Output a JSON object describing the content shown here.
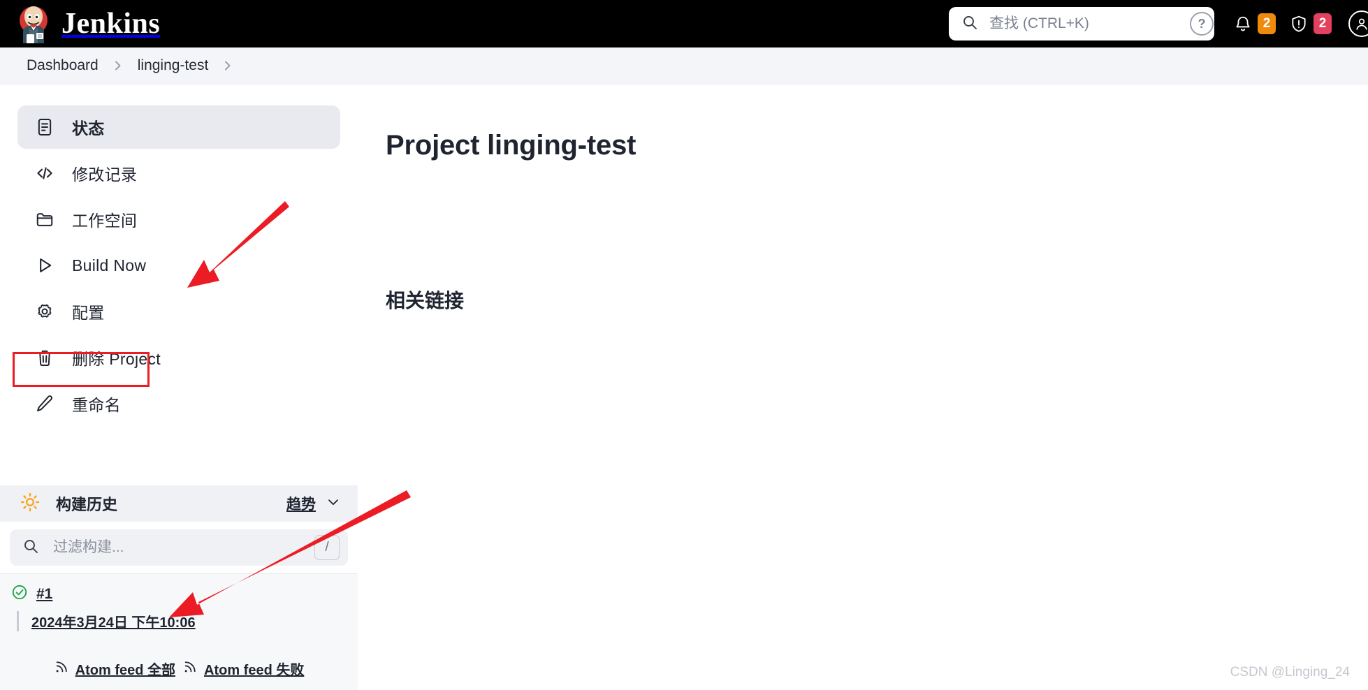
{
  "header": {
    "brand_title": "Jenkins",
    "logo_icon": "jenkins-butler-logo",
    "search": {
      "placeholder": "查找 (CTRL+K)",
      "value": "",
      "icon": "search-icon"
    },
    "help_icon_label": "?",
    "notifications": {
      "bell_icon": "bell-icon",
      "count": "2",
      "color": "#ef8b0c"
    },
    "security": {
      "shield_icon": "shield-warning-icon",
      "count": "2",
      "color": "#e4405f"
    },
    "account_icon": "user-avatar-icon"
  },
  "breadcrumb": {
    "items": [
      {
        "label": "Dashboard"
      },
      {
        "label": "linging-test"
      }
    ],
    "separator": "›",
    "trailing_separator": "›"
  },
  "sidebar": {
    "items": [
      {
        "label": "状态",
        "icon": "document-status-icon",
        "active": true
      },
      {
        "label": "修改记录",
        "icon": "code-brackets-icon",
        "active": false
      },
      {
        "label": "工作空间",
        "icon": "folder-icon",
        "active": false
      },
      {
        "label": "Build Now",
        "icon": "play-triangle-icon",
        "active": false,
        "annotated": true
      },
      {
        "label": "配置",
        "icon": "gear-icon",
        "active": false
      },
      {
        "label": "删除 Project",
        "icon": "trash-icon",
        "active": false
      },
      {
        "label": "重命名",
        "icon": "pencil-icon",
        "active": false
      }
    ]
  },
  "build_history": {
    "title": "构建历史",
    "weather_icon": "sun-icon",
    "trend_label": "趋势",
    "trend_chevron_icon": "chevron-down-icon",
    "filter": {
      "placeholder": "过滤构建...",
      "value": "",
      "icon": "search-icon",
      "shortcut_key": "/"
    },
    "builds": [
      {
        "status_icon": "check-circle-icon",
        "status_color": "#1ea64a",
        "number": "#1",
        "date": "2024年3月24日 下午10:06"
      }
    ],
    "feeds": [
      {
        "label": "Atom feed 全部",
        "icon": "rss-icon"
      },
      {
        "label": "Atom feed 失败",
        "icon": "rss-icon"
      }
    ]
  },
  "main": {
    "page_title": "Project linging-test",
    "section_title": "相关链接"
  },
  "annotations": {
    "highlight_color": "#ec1c24",
    "arrow_count": 2,
    "boxed_item": "Build Now"
  },
  "watermark": "CSDN @Linging_24"
}
